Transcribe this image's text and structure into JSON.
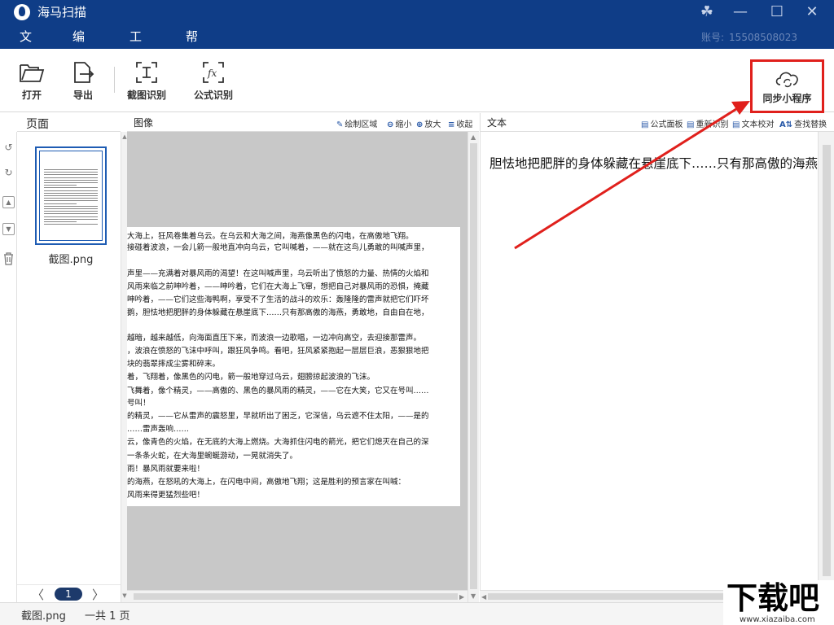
{
  "titlebar": {
    "title": "海马扫描",
    "account_label": "账号:",
    "account_value": "15508508023",
    "menu": [
      "文件",
      "编辑",
      "工具",
      "帮助"
    ]
  },
  "toolbar": {
    "open": "打开",
    "export": "导出",
    "crop_ocr": "截图识别",
    "formula_ocr": "公式识别",
    "sync_miniprogram": "同步小程序"
  },
  "pages_panel": {
    "title": "页面",
    "thumbnail_name": "截图.png",
    "current_page": "1"
  },
  "image_panel": {
    "title": "图像",
    "buttons": [
      "绘制区域",
      "缩小",
      "放大",
      "收起"
    ],
    "lines": [
      "大海上，狂风卷集着乌云。在乌云和大海之间，海燕像黑色的闪电，在高傲地飞翔。",
      "接碰着波浪，一会儿箭一般地直冲向乌云，它叫喊着，——就在这鸟儿勇敢的叫喊声里，",
      "",
      "声里——充满着对暴风雨的渴望！在这叫喊声里，乌云听出了愤怒的力量、热情的火焰和",
      "风雨来临之前呻吟着，——呻吟着，它们在大海上飞窜，想把自己对暴风雨的恐惧，掩藏",
      "呻吟着，——它们这些海鸭啊，享受不了生活的战斗的欢乐：轰隆隆的雷声就把它们吓坏",
      "鹅，胆怯地把肥胖的身体躲藏在悬崖底下……只有那高傲的海燕，勇敢地，自由自在地，",
      "",
      "越暗，越来越低，向海面直压下来，而波浪一边歌唱，一边冲向高空，去迎接那雷声。",
      "，波浪在愤怒的飞沫中呼叫，跟狂风争鸣。看吧，狂风紧紧抱起一层层巨浪，恶狠狠地把",
      "块的翡翠摔成尘雾和碎末。",
      "着，飞翔着，像黑色的闪电，箭一般地穿过乌云，翅膀掠起波浪的飞沫。",
      "飞舞着，像个精灵，——高傲的、黑色的暴风雨的精灵，——它在大笑，它又在号叫……",
      "号叫！",
      "的精灵，——它从雷声的震怒里，早就听出了困乏，它深信，乌云遮不住太阳，——是的",
      "……雷声轰响……",
      "云，像青色的火焰，在无底的大海上燃烧。大海抓住闪电的箭光，把它们熄灭在自己的深",
      "一条条火蛇，在大海里蜿蜒游动，一晃就消失了。",
      "雨！暴风雨就要来啦！",
      "的海燕，在怒吼的大海上，在闪电中间，高傲地飞翔；这是胜利的预言家在叫喊：",
      "风雨来得更猛烈些吧！"
    ]
  },
  "text_panel": {
    "title": "文本",
    "buttons": [
      "公式面板",
      "重新识别",
      "文本校对",
      "查找替换"
    ],
    "content": "胆怯地把肥胖的身体躲藏在悬崖底下……只有那高傲的海燕"
  },
  "statusbar": {
    "filename": "截图.png",
    "page_count": "一共 1 页"
  },
  "watermark": {
    "main": "下载吧",
    "url": "www.xiazaiba.com"
  },
  "colors": {
    "titlebar_bg": "#0f3d87",
    "highlight_red": "#e0201c",
    "selection_blue": "#1e5cb3"
  }
}
